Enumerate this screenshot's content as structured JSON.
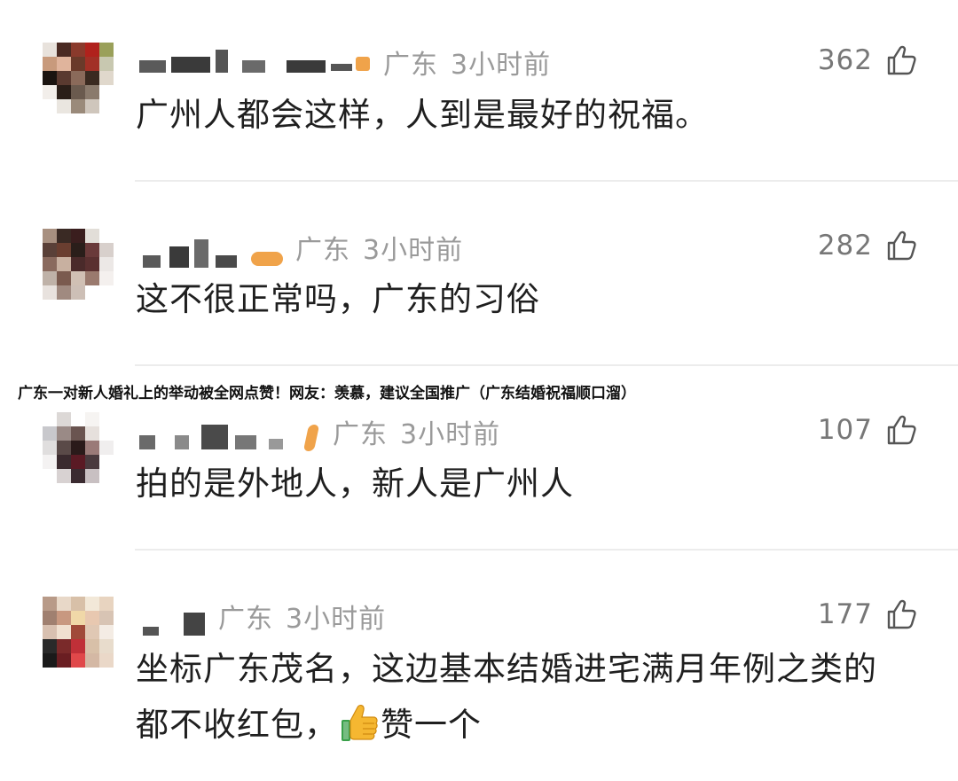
{
  "banner": {
    "text": "广东一对新人婚礼上的举动被全网点赞！网友：羡慕，建议全国推广（广东结婚祝福顺口溜）"
  },
  "comments": [
    {
      "location": "广东",
      "time": "3小时前",
      "likes": "362",
      "text": "广州人都会这样，人到是最好的祝福。"
    },
    {
      "location": "广东",
      "time": "3小时前",
      "likes": "282",
      "text": "这不很正常吗，广东的习俗"
    },
    {
      "location": "广东",
      "time": "3小时前",
      "likes": "107",
      "text": "拍的是外地人，新人是广州人"
    },
    {
      "location": "广东",
      "time": "3小时前",
      "likes": "177",
      "text_line1": "坐标广东茂名，这边基本结婚进宅满月年例之类的",
      "text_line2_a": "都不收红包，",
      "text_line2_b": "赞一个",
      "emoji": "thumbs-up-emoji"
    }
  ],
  "icons": {
    "like": "thumbs-up-outline-icon"
  },
  "colors": {
    "meta": "#9a9a9a",
    "text": "#1f1f1f",
    "divider": "#ececec",
    "emoji": "#f5b731"
  }
}
